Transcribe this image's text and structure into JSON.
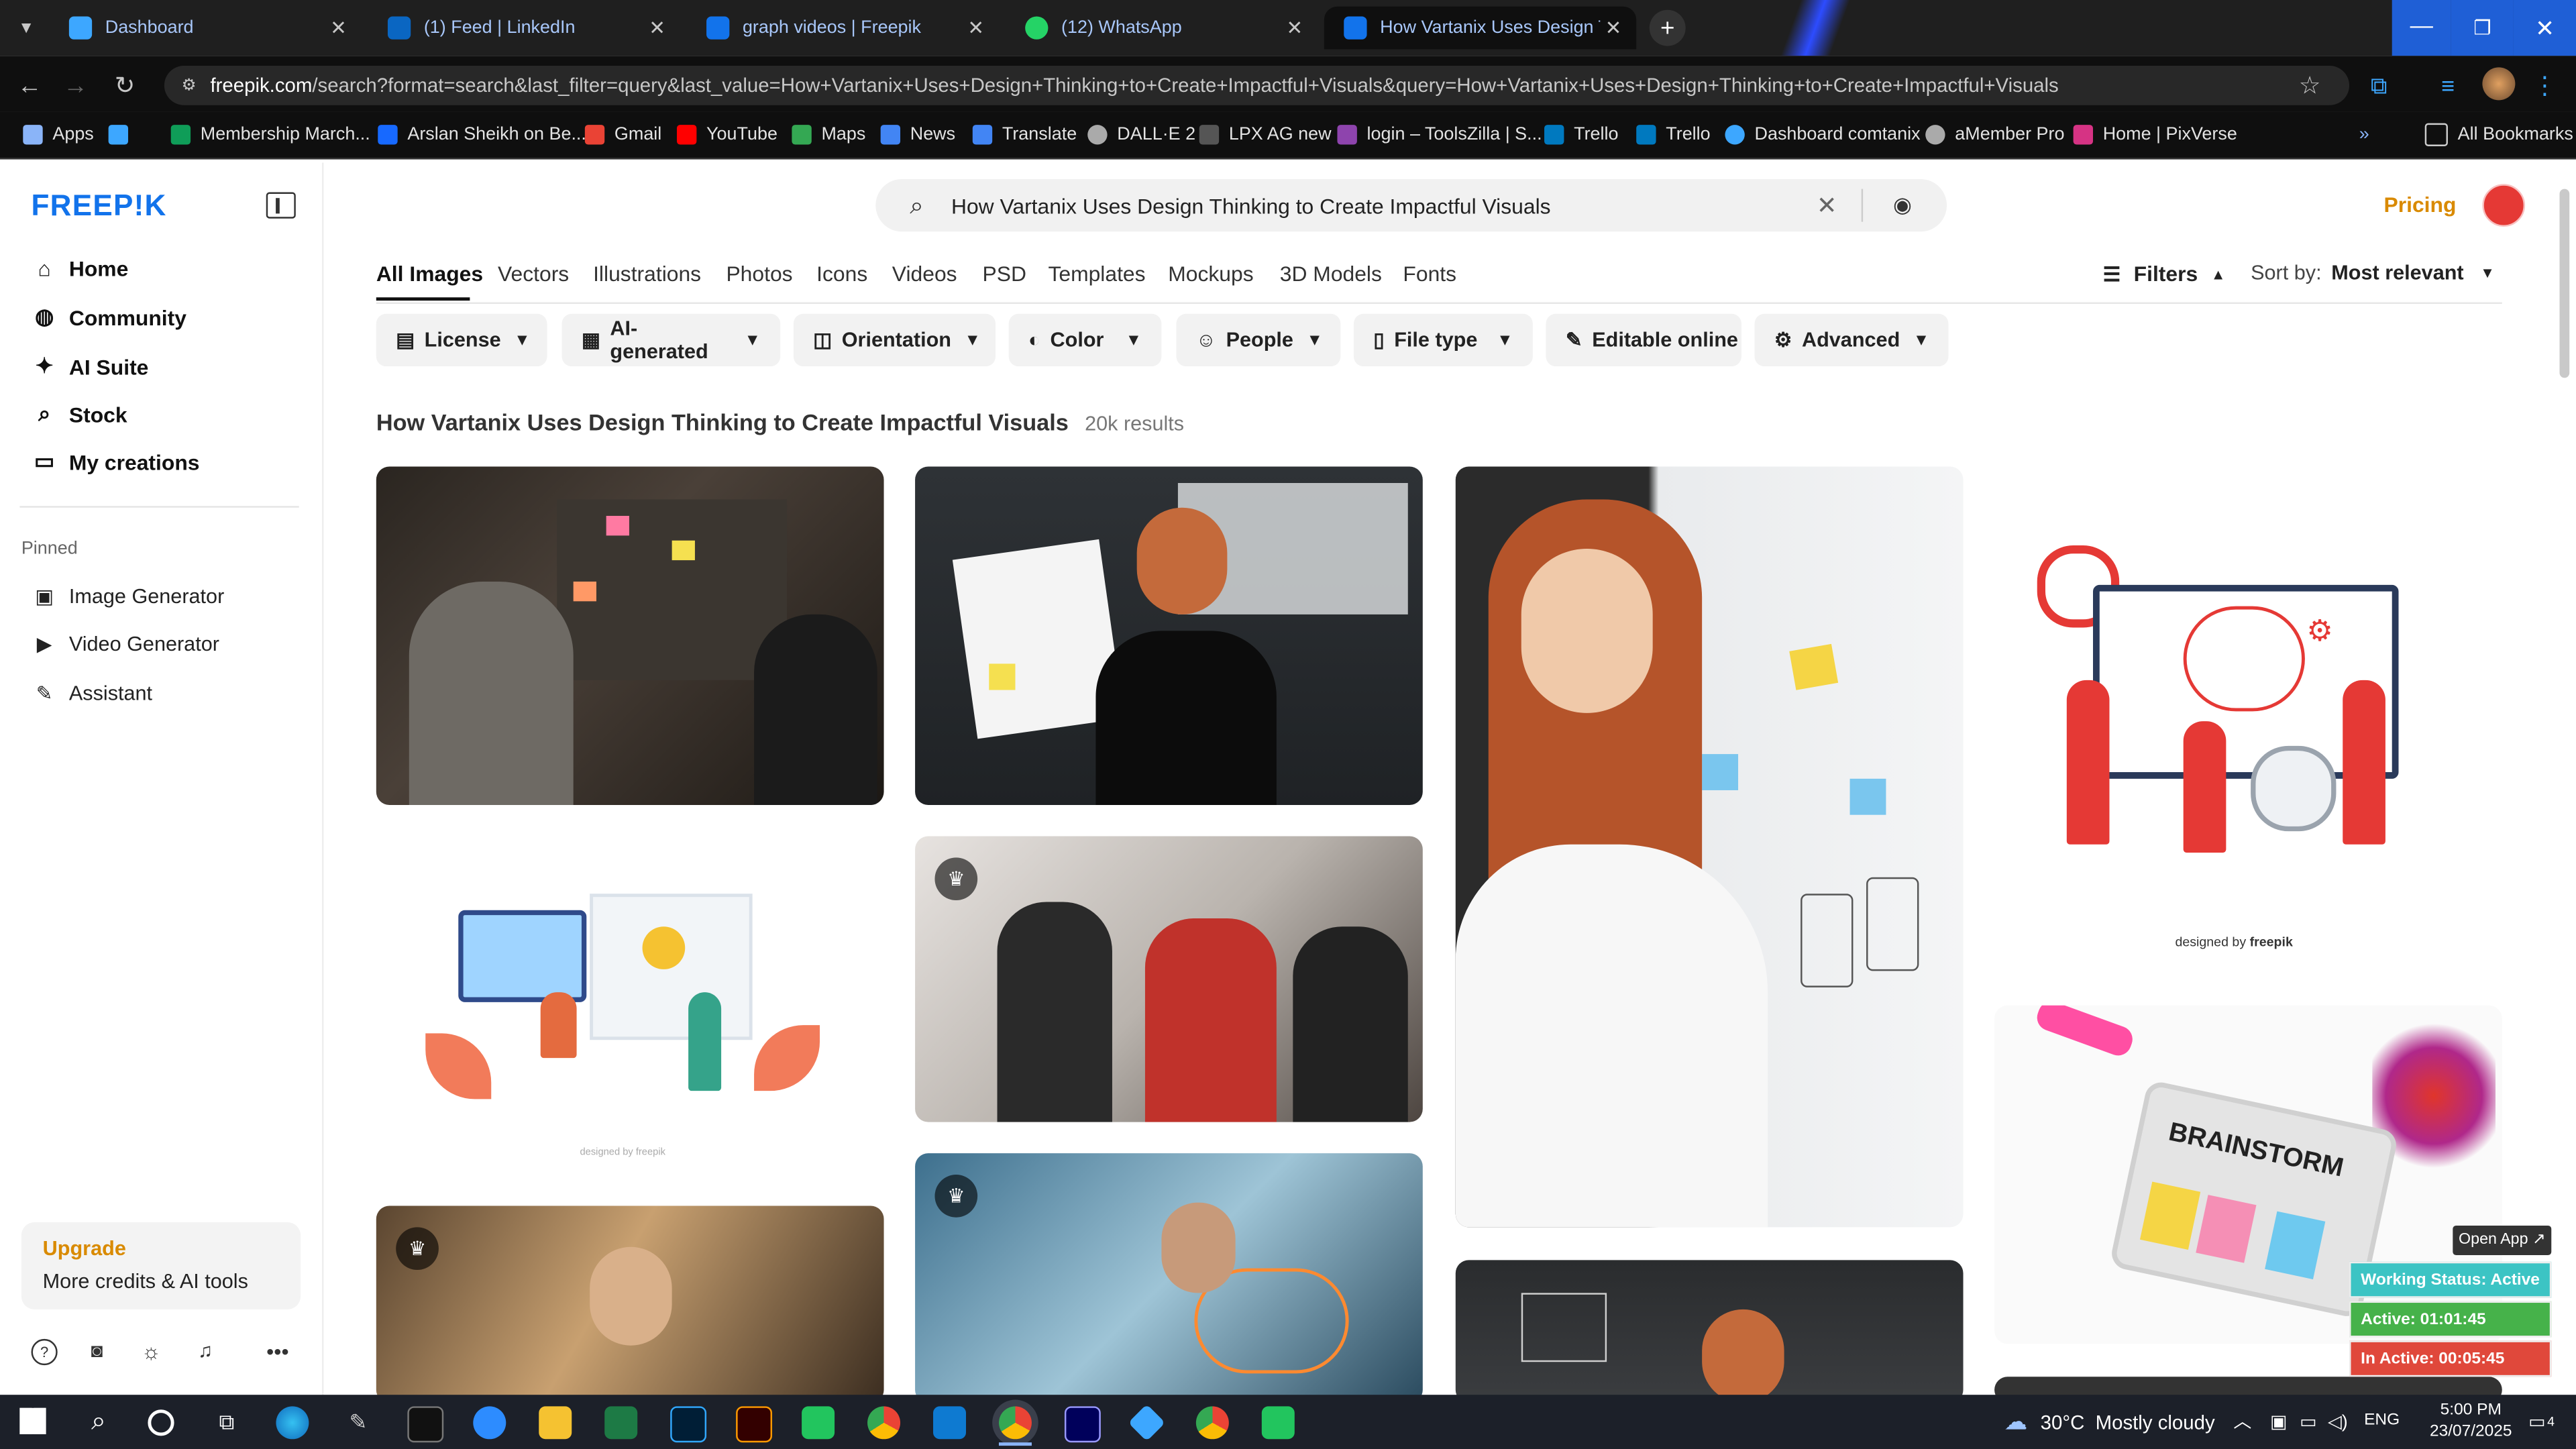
{
  "browser": {
    "tabs": [
      {
        "title": "Dashboard",
        "color": "#3da7ff"
      },
      {
        "title": "(1) Feed | LinkedIn",
        "color": "#0a66c2"
      },
      {
        "title": "graph videos | Freepik",
        "color": "#1273eb"
      },
      {
        "title": "(12) WhatsApp",
        "color": "#25d366"
      },
      {
        "title": "How Vartanix Uses Design Thin",
        "color": "#1273eb"
      }
    ],
    "url_host": "freepik.com",
    "url_rest": "/search?format=search&last_filter=query&last_value=How+Vartanix+Uses+Design+Thinking+to+Create+Impactful+Visuals&query=How+Vartanix+Uses+Design+Thinking+to+Create+Impactful+Visuals",
    "bookmarks": [
      {
        "label": "Apps",
        "color": "#8ab4f8"
      },
      {
        "label": "Membership March...",
        "color": "#0f9d58"
      },
      {
        "label": "Arslan Sheikh on Be...",
        "color": "#1769ff"
      },
      {
        "label": "Gmail",
        "color": "#ea4335"
      },
      {
        "label": "YouTube",
        "color": "#ff0000"
      },
      {
        "label": "Maps",
        "color": "#34a853"
      },
      {
        "label": "News",
        "color": "#4285f4"
      },
      {
        "label": "Translate",
        "color": "#4285f4"
      },
      {
        "label": "DALL·E 2",
        "color": "#aaaaaa"
      },
      {
        "label": "LPX AG new",
        "color": "#555555"
      },
      {
        "label": "login – ToolsZilla | S...",
        "color": "#8e44ad"
      },
      {
        "label": "Trello",
        "color": "#0079bf"
      },
      {
        "label": "Trello",
        "color": "#0079bf"
      },
      {
        "label": "Dashboard comtanix",
        "color": "#3da7ff"
      },
      {
        "label": "aMember Pro",
        "color": "#aaaaaa"
      },
      {
        "label": "Home | PixVerse",
        "color": "#d63384"
      }
    ],
    "all_bookmarks": "All Bookmarks"
  },
  "sidebar": {
    "logo": "FREEP!K",
    "nav": [
      {
        "label": "Home",
        "icon": "home-icon"
      },
      {
        "label": "Community",
        "icon": "globe-icon"
      },
      {
        "label": "AI Suite",
        "icon": "sparkle-icon"
      },
      {
        "label": "Stock",
        "icon": "search-icon"
      },
      {
        "label": "My creations",
        "icon": "folder-icon"
      }
    ],
    "pinned_label": "Pinned",
    "pinned": [
      {
        "label": "Image Generator",
        "icon": "image-icon"
      },
      {
        "label": "Video Generator",
        "icon": "video-icon"
      },
      {
        "label": "Assistant",
        "icon": "assistant-icon"
      }
    ],
    "upgrade_title": "Upgrade",
    "upgrade_sub": "More credits & AI tools"
  },
  "search": {
    "query": "How Vartanix Uses Design Thinking to Create Impactful Visuals",
    "pricing": "Pricing"
  },
  "categories": [
    "All Images",
    "Vectors",
    "Illustrations",
    "Photos",
    "Icons",
    "Videos",
    "PSD",
    "Templates",
    "Mockups",
    "3D Models",
    "Fonts"
  ],
  "filters_label": "Filters",
  "sort_label": "Sort by:",
  "sort_value": "Most relevant",
  "chips": [
    {
      "label": "License",
      "icon": "license-icon"
    },
    {
      "label": "AI-generated",
      "icon": "ai-icon"
    },
    {
      "label": "Orientation",
      "icon": "orientation-icon"
    },
    {
      "label": "Color",
      "icon": "palette-icon"
    },
    {
      "label": "People",
      "icon": "people-icon"
    },
    {
      "label": "File type",
      "icon": "file-icon"
    },
    {
      "label": "Editable online",
      "icon": "pen-icon"
    },
    {
      "label": "Advanced",
      "icon": "settings-icon"
    }
  ],
  "results": {
    "title": "How Vartanix Uses Design Thinking to Create Impactful Visuals",
    "count": "20k results",
    "designed_by": "designed by",
    "freepik": "freepik",
    "brainstorm": "BRAINSTORM"
  },
  "widget": {
    "open_app": "Open App ↗",
    "status": "Working Status: Active",
    "active": "Active: 01:01:45",
    "inactive": "In Active: 00:05:45"
  },
  "taskbar": {
    "weather": "30°C  Mostly cloudy",
    "lang": "ENG",
    "time": "5:00 PM",
    "date": "23/07/2025",
    "notif": "4"
  }
}
